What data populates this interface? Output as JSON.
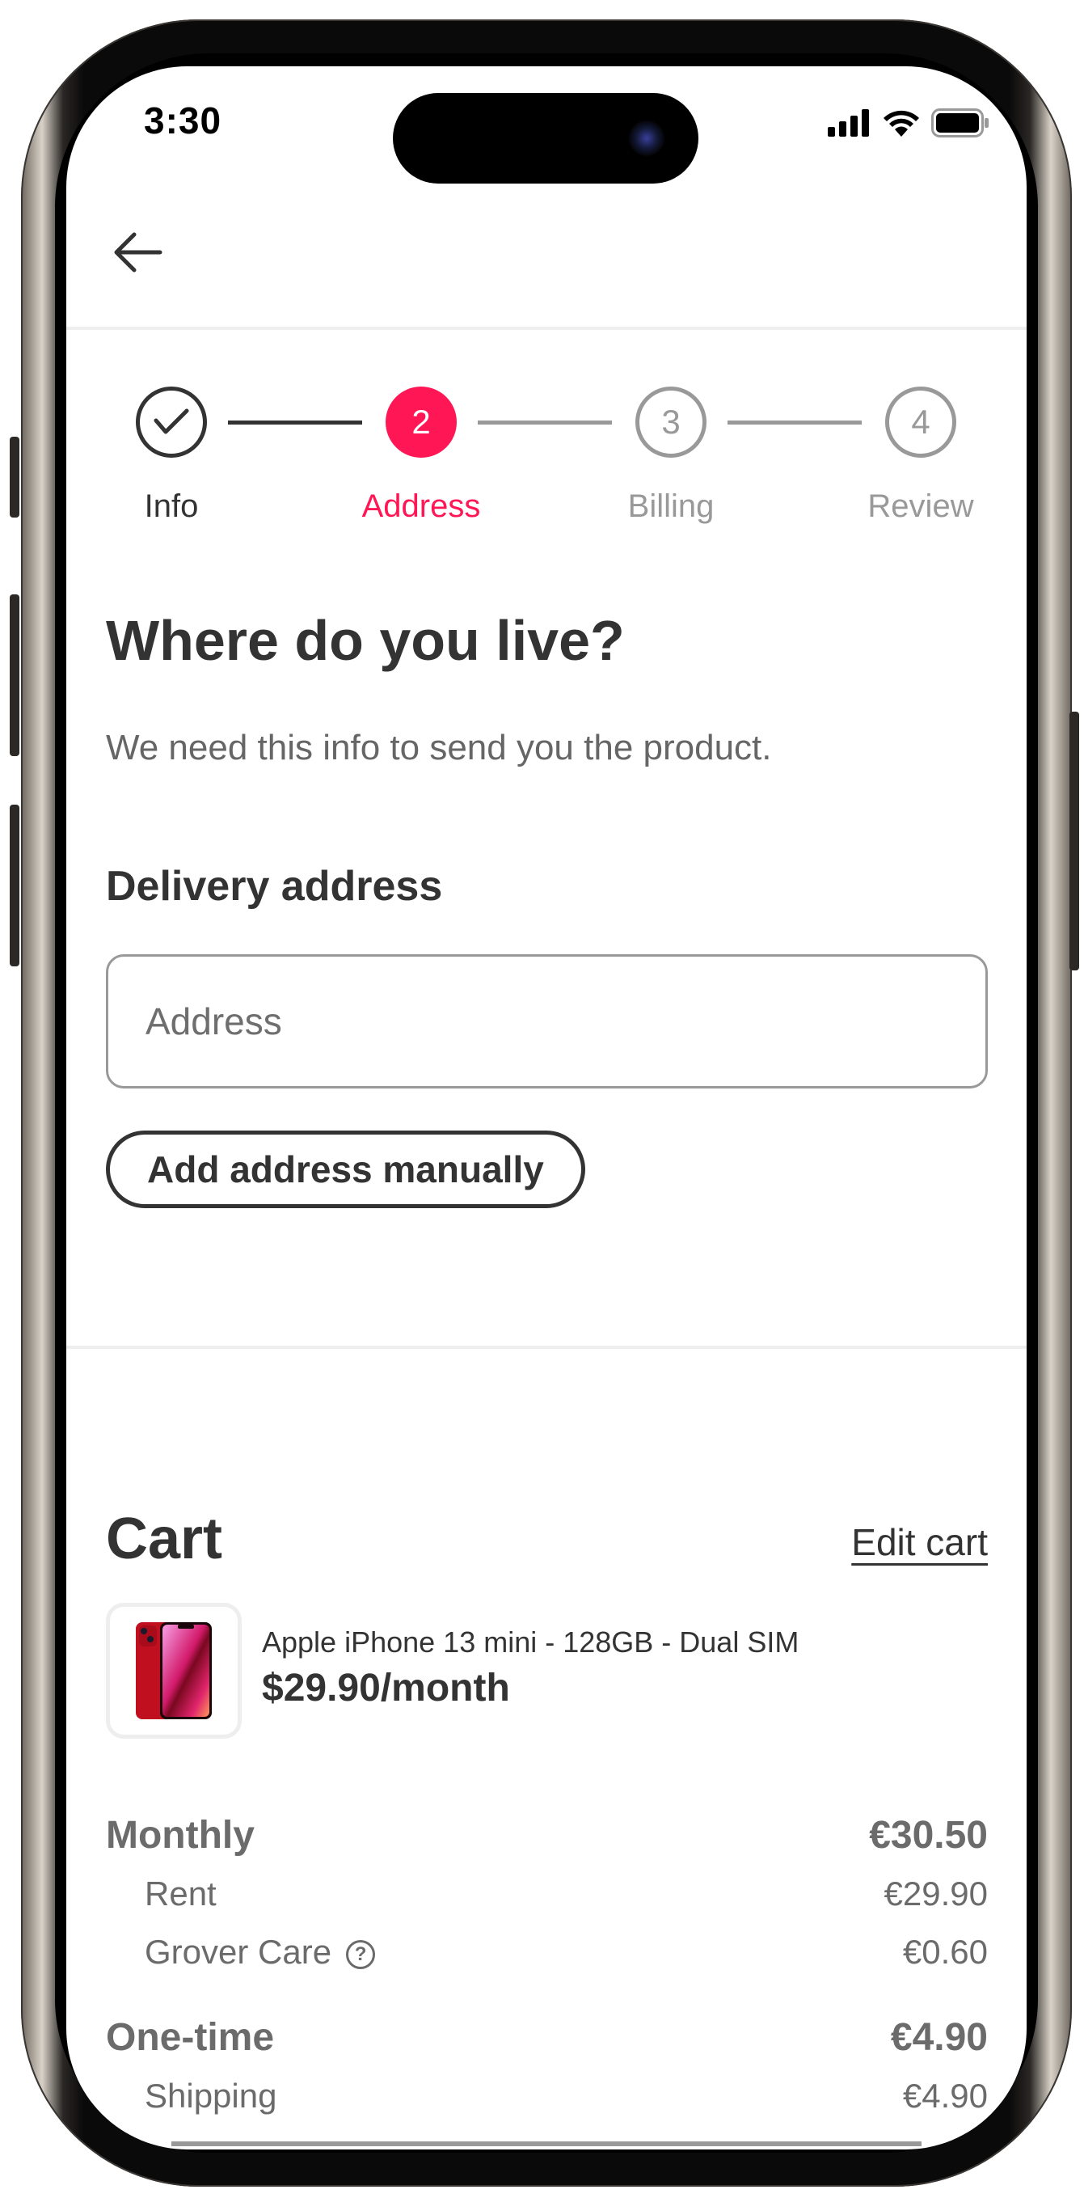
{
  "status_bar": {
    "time": "3:30",
    "icons": [
      "cellular-signal-icon",
      "wifi-icon",
      "battery-icon"
    ]
  },
  "nav": {
    "back_icon": "arrow-left-icon"
  },
  "stepper": {
    "active_color": "#FF1755",
    "steps": [
      {
        "number": "1",
        "label": "Info",
        "state": "completed"
      },
      {
        "number": "2",
        "label": "Address",
        "state": "active"
      },
      {
        "number": "3",
        "label": "Billing",
        "state": "upcoming"
      },
      {
        "number": "4",
        "label": "Review",
        "state": "upcoming"
      }
    ]
  },
  "form": {
    "title": "Where do you live?",
    "subtitle": "We need this info to send you the product.",
    "section_label": "Delivery address",
    "address_input": {
      "value": "",
      "placeholder": "Address"
    },
    "manual_button_label": "Add address manually"
  },
  "cart": {
    "title": "Cart",
    "edit_label": "Edit cart",
    "item": {
      "name": "Apple iPhone 13 mini - 128GB - Dual SIM",
      "price": "$29.90/month",
      "image": "iphone-13-mini-red-image"
    },
    "summary": {
      "monthly": {
        "label": "Monthly",
        "total": "€30.50",
        "lines": [
          {
            "label": "Rent",
            "value": "€29.90",
            "help": false
          },
          {
            "label": "Grover Care",
            "value": "€0.60",
            "help": true
          }
        ]
      },
      "one_time": {
        "label": "One-time",
        "total": "€4.90",
        "lines": [
          {
            "label": "Shipping",
            "value": "€4.90",
            "help": false
          }
        ]
      }
    }
  }
}
